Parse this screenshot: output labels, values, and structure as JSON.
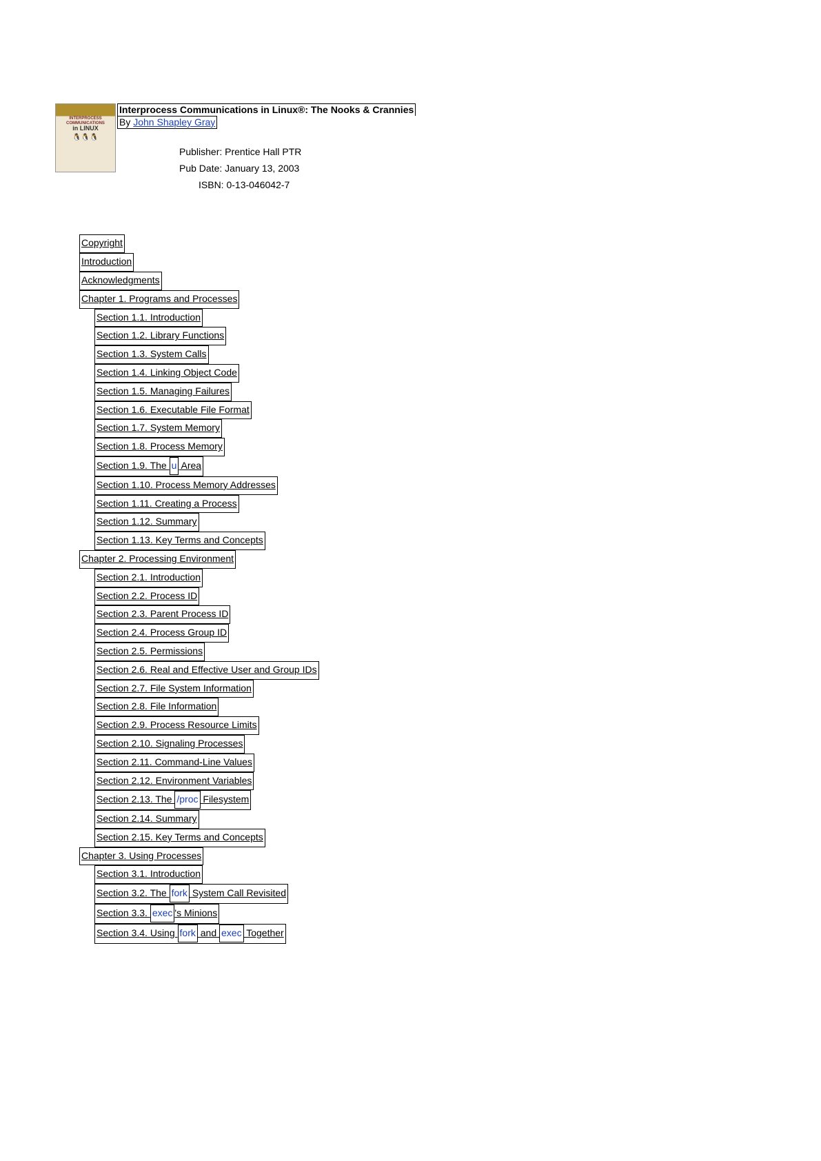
{
  "cover": {
    "line1": "INTERPROCESS",
    "line2": "COMMUNICATIONS",
    "line3": "in LINUX"
  },
  "title": "Interprocess Communications in Linux®: The Nooks & Crannies",
  "byline": {
    "by": "By ",
    "author": "John Shapley Gray"
  },
  "pub": {
    "publisher": "Publisher: Prentice Hall PTR",
    "date": "Pub Date: January 13, 2003",
    "isbn": "ISBN: 0-13-046042-7"
  },
  "toc": {
    "copyright": "Copyright",
    "intro": "Introduction",
    "ack": "Acknowledgments",
    "ch1": {
      "title": "Chapter 1.  Programs and Processes",
      "s1": "Section 1.1.  Introduction",
      "s2": "Section 1.2.  Library Functions",
      "s3": "Section 1.3.  System Calls",
      "s4": "Section 1.4.  Linking Object Code",
      "s5": "Section 1.5.  Managing Failures",
      "s6": "Section 1.6.  Executable File Format",
      "s7": "Section 1.7.  System Memory",
      "s8": "Section 1.8.  Process Memory",
      "s9a": "Section 1.9.  The ",
      "s9kw": "u",
      "s9b": " Area",
      "s10": "Section 1.10.  Process Memory Addresses",
      "s11": "Section 1.11.  Creating a Process",
      "s12": "Section 1.12.  Summary",
      "s13": "Section 1.13.  Key Terms and Concepts"
    },
    "ch2": {
      "title": "Chapter 2.  Processing Environment",
      "s1": "Section 2.1.  Introduction",
      "s2": "Section 2.2.  Process ID",
      "s3": "Section 2.3.  Parent Process ID",
      "s4": "Section 2.4.  Process Group ID",
      "s5": "Section 2.5.  Permissions",
      "s6": "Section 2.6.  Real and Effective User and Group IDs",
      "s7": "Section 2.7.  File System Information",
      "s8": "Section 2.8.  File Information",
      "s9": "Section 2.9.  Process Resource Limits",
      "s10": "Section 2.10.  Signaling Processes",
      "s11": "Section 2.11.  Command-Line Values",
      "s12": "Section 2.12.  Environment Variables",
      "s13a": "Section 2.13.  The ",
      "s13kw": "/proc",
      "s13b": " Filesystem",
      "s14": "Section 2.14.  Summary",
      "s15": "Section 2.15.  Key Terms and Concepts"
    },
    "ch3": {
      "title": "Chapter 3.  Using Processes",
      "s1": "Section 3.1.  Introduction",
      "s2a": "Section 3.2.  The ",
      "s2kw": "fork",
      "s2b": " System Call Revisited",
      "s3a": "Section 3.3.  ",
      "s3kw": "exec",
      "s3b": "'s Minions",
      "s4a": "Section 3.4.  Using ",
      "s4kw1": "fork",
      "s4mid": " and ",
      "s4kw2": "exec",
      "s4b": " Together"
    }
  }
}
